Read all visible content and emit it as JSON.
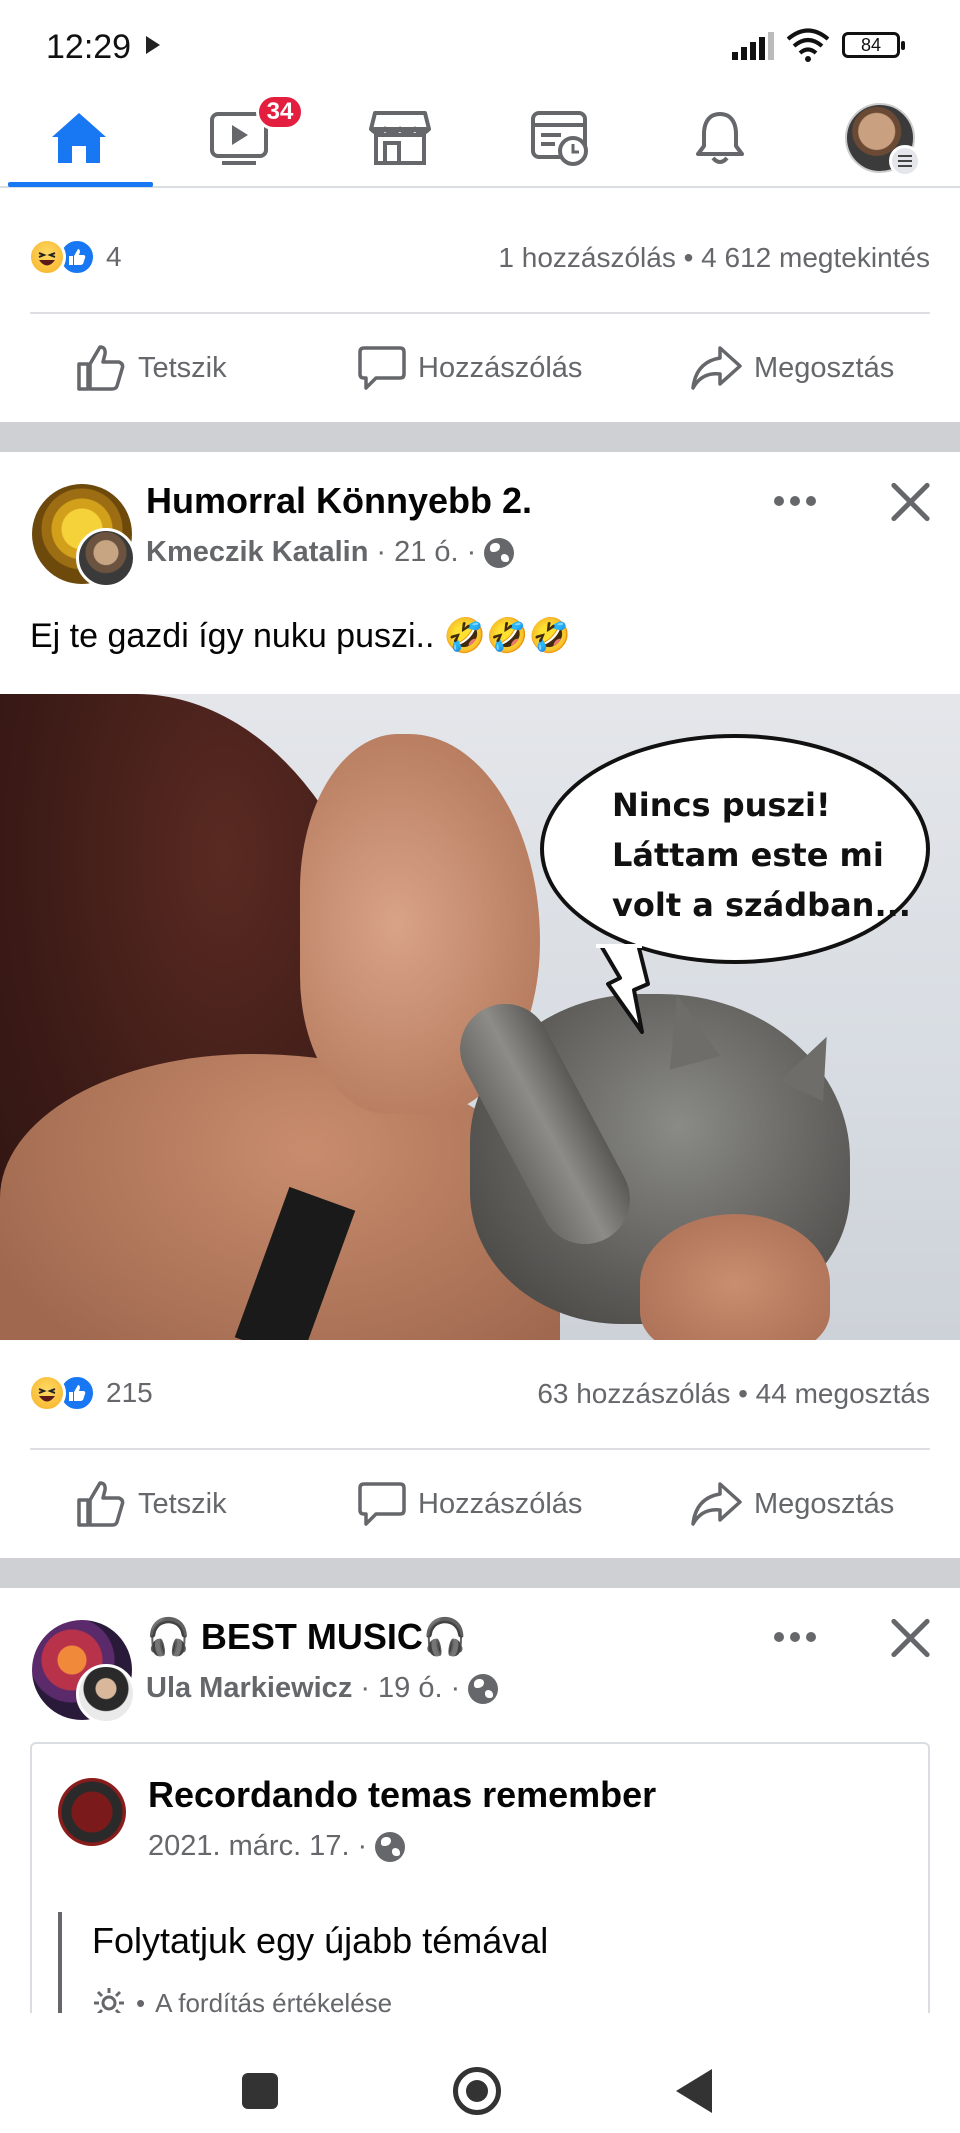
{
  "status_bar": {
    "time": "12:29",
    "battery": "84"
  },
  "top_nav": {
    "items": [
      {
        "name": "home",
        "active": true
      },
      {
        "name": "watch",
        "badge": "34"
      },
      {
        "name": "marketplace"
      },
      {
        "name": "news"
      },
      {
        "name": "notifications"
      },
      {
        "name": "profile-menu"
      }
    ],
    "accent_color": "#1877f2"
  },
  "prev_post": {
    "reaction_count": "4",
    "stats": "1 hozzászólás • 4 612 megtekintés",
    "actions": {
      "like": "Tetszik",
      "comment": "Hozzászólás",
      "share": "Megosztás"
    }
  },
  "post1": {
    "group": "Humorral Könnyebb 2.",
    "author": "Kmeczik Katalin",
    "time": "21 ó.",
    "text": "Ej te gazdi így nuku puszi.. 🤣🤣🤣",
    "image_bubble_lines": [
      "Nincs puszi!",
      "Láttam este mi",
      "volt a szádban..."
    ],
    "reaction_count": "215",
    "stats": "63 hozzászólás • 44 megosztás",
    "actions": {
      "like": "Tetszik",
      "comment": "Hozzászólás",
      "share": "Megosztás"
    }
  },
  "post2": {
    "group": "🎧 BEST MUSIC🎧",
    "author": "Ula Markiewicz",
    "time": "19 ó.",
    "shared": {
      "title": "Recordando temas remember",
      "date": "2021. márc. 17.",
      "text": "Folytatjuk egy újabb témával",
      "translate": "A fordítás értékelése"
    }
  }
}
